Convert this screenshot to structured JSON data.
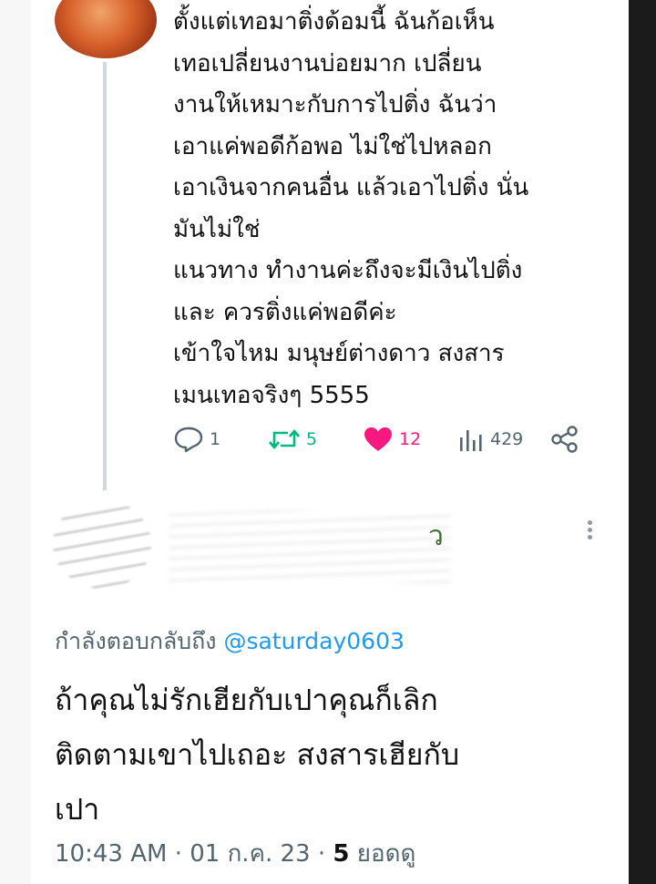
{
  "tweet": {
    "lines": [
      "ตั้งแต่เทอมาติ่งด้อมนี้  ฉันก้อเห็น",
      "เทอเปลี่ยนงานบ่อยมาก เปลี่ยน",
      "งานให้เหมาะกับการไปติ่ง ฉันว่า",
      "เอาแค่พอดีก้อพอ ไม่ใช่ไปหลอก",
      "เอาเงินจากคนอื่น แล้วเอาไปติ่ง นั่น",
      "มันไม่ใช่",
      "แนวทาง ทำงานค่ะถึงจะมีเงินไปติ่ง",
      "และ ควรติ่งแค่พอดีค่ะ",
      "เข้าใจไหม มนุษย์ต่างดาว สงสาร",
      "เมนเทอจริงๆ 5555"
    ],
    "actions": {
      "replies": "1",
      "retweets": "5",
      "likes": "12",
      "views": "429"
    }
  },
  "reply": {
    "obscured_name_fragment": "ว",
    "replying_prefix": "กำลังตอบกลับถึง",
    "replying_handle": "@saturday0603",
    "lines": [
      "ถ้าคุณไม่รักเฮียกับเปาคุณก็เลิก",
      "ติดตามเขาไปเถอะ สงสารเฮียกับ",
      "เปา"
    ],
    "time": "10:43 AM",
    "date": "01 ก.ค. 23",
    "views_count": "5",
    "views_label": "ยอดดู"
  },
  "colors": {
    "link": "#1d9bf0",
    "retweet": "#00ba7c",
    "like": "#f91880",
    "muted": "#536471"
  }
}
